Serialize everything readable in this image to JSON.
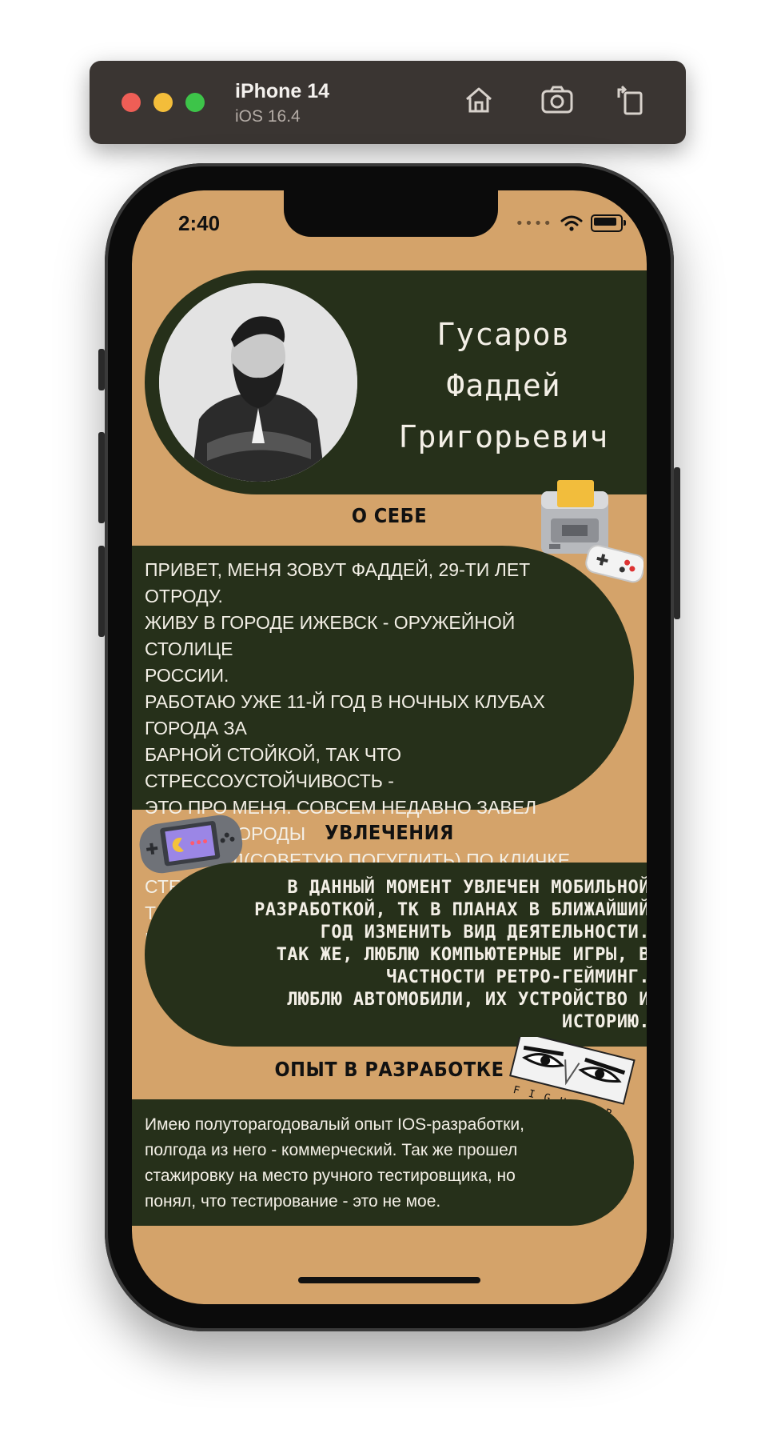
{
  "simulator": {
    "device": "iPhone 14",
    "os": "iOS 16.4"
  },
  "status_bar": {
    "time": "2:40"
  },
  "profile": {
    "name_line1": "Гусаров",
    "name_line2": "Фаддей",
    "name_line3": "Григорьевич"
  },
  "about": {
    "title": "О СЕБЕ",
    "text": "Привет, меня зовут Фаддей, 29-ти лет отроду.\nЖиву в городе Ижевск - оружейной столице\nРоссии.\nРаботаю уже 11-й год в ночных клубах города за\nбарной стойкой, так что стрессоустойчивость -\nэто про меня. Совсем недавно завел собаку породы\nКеесхонд(советую погуглить) по кличке Степка.\nТак же имею супертолстого и пушистого кота\nВасилия. Ах да, еще счастливо женат."
  },
  "hobbies": {
    "title": "УВЛЕЧЕНИЯ",
    "text": "В данный момент увлечен мобильной\nразработкой, тк в планах в ближайший\nгод изменить вид деятельности.\nТак же, люблю компьютерные игры, в\nчастности ретро-гейминг.\nЛюблю автомобили, их устройство и\nисторию."
  },
  "experience": {
    "title": "ОПЫТ В РАЗРАБОТКЕ",
    "text": "Имею полуторагодовалый опыт IOS-разработки,\nполгода из него - коммерческий. Так же прошел\nстажировку на место ручного тестировщика, но\nпонял, что тестирование - это не мое."
  },
  "stickers": {
    "fighter_label": "FIGHTER"
  },
  "colors": {
    "background": "#d4a36a",
    "card": "#26301a",
    "text_light": "#f3efe6"
  },
  "icons": [
    "home-icon",
    "screenshot-icon",
    "rotate-icon",
    "wifi-icon",
    "battery-icon",
    "signal-icon"
  ]
}
